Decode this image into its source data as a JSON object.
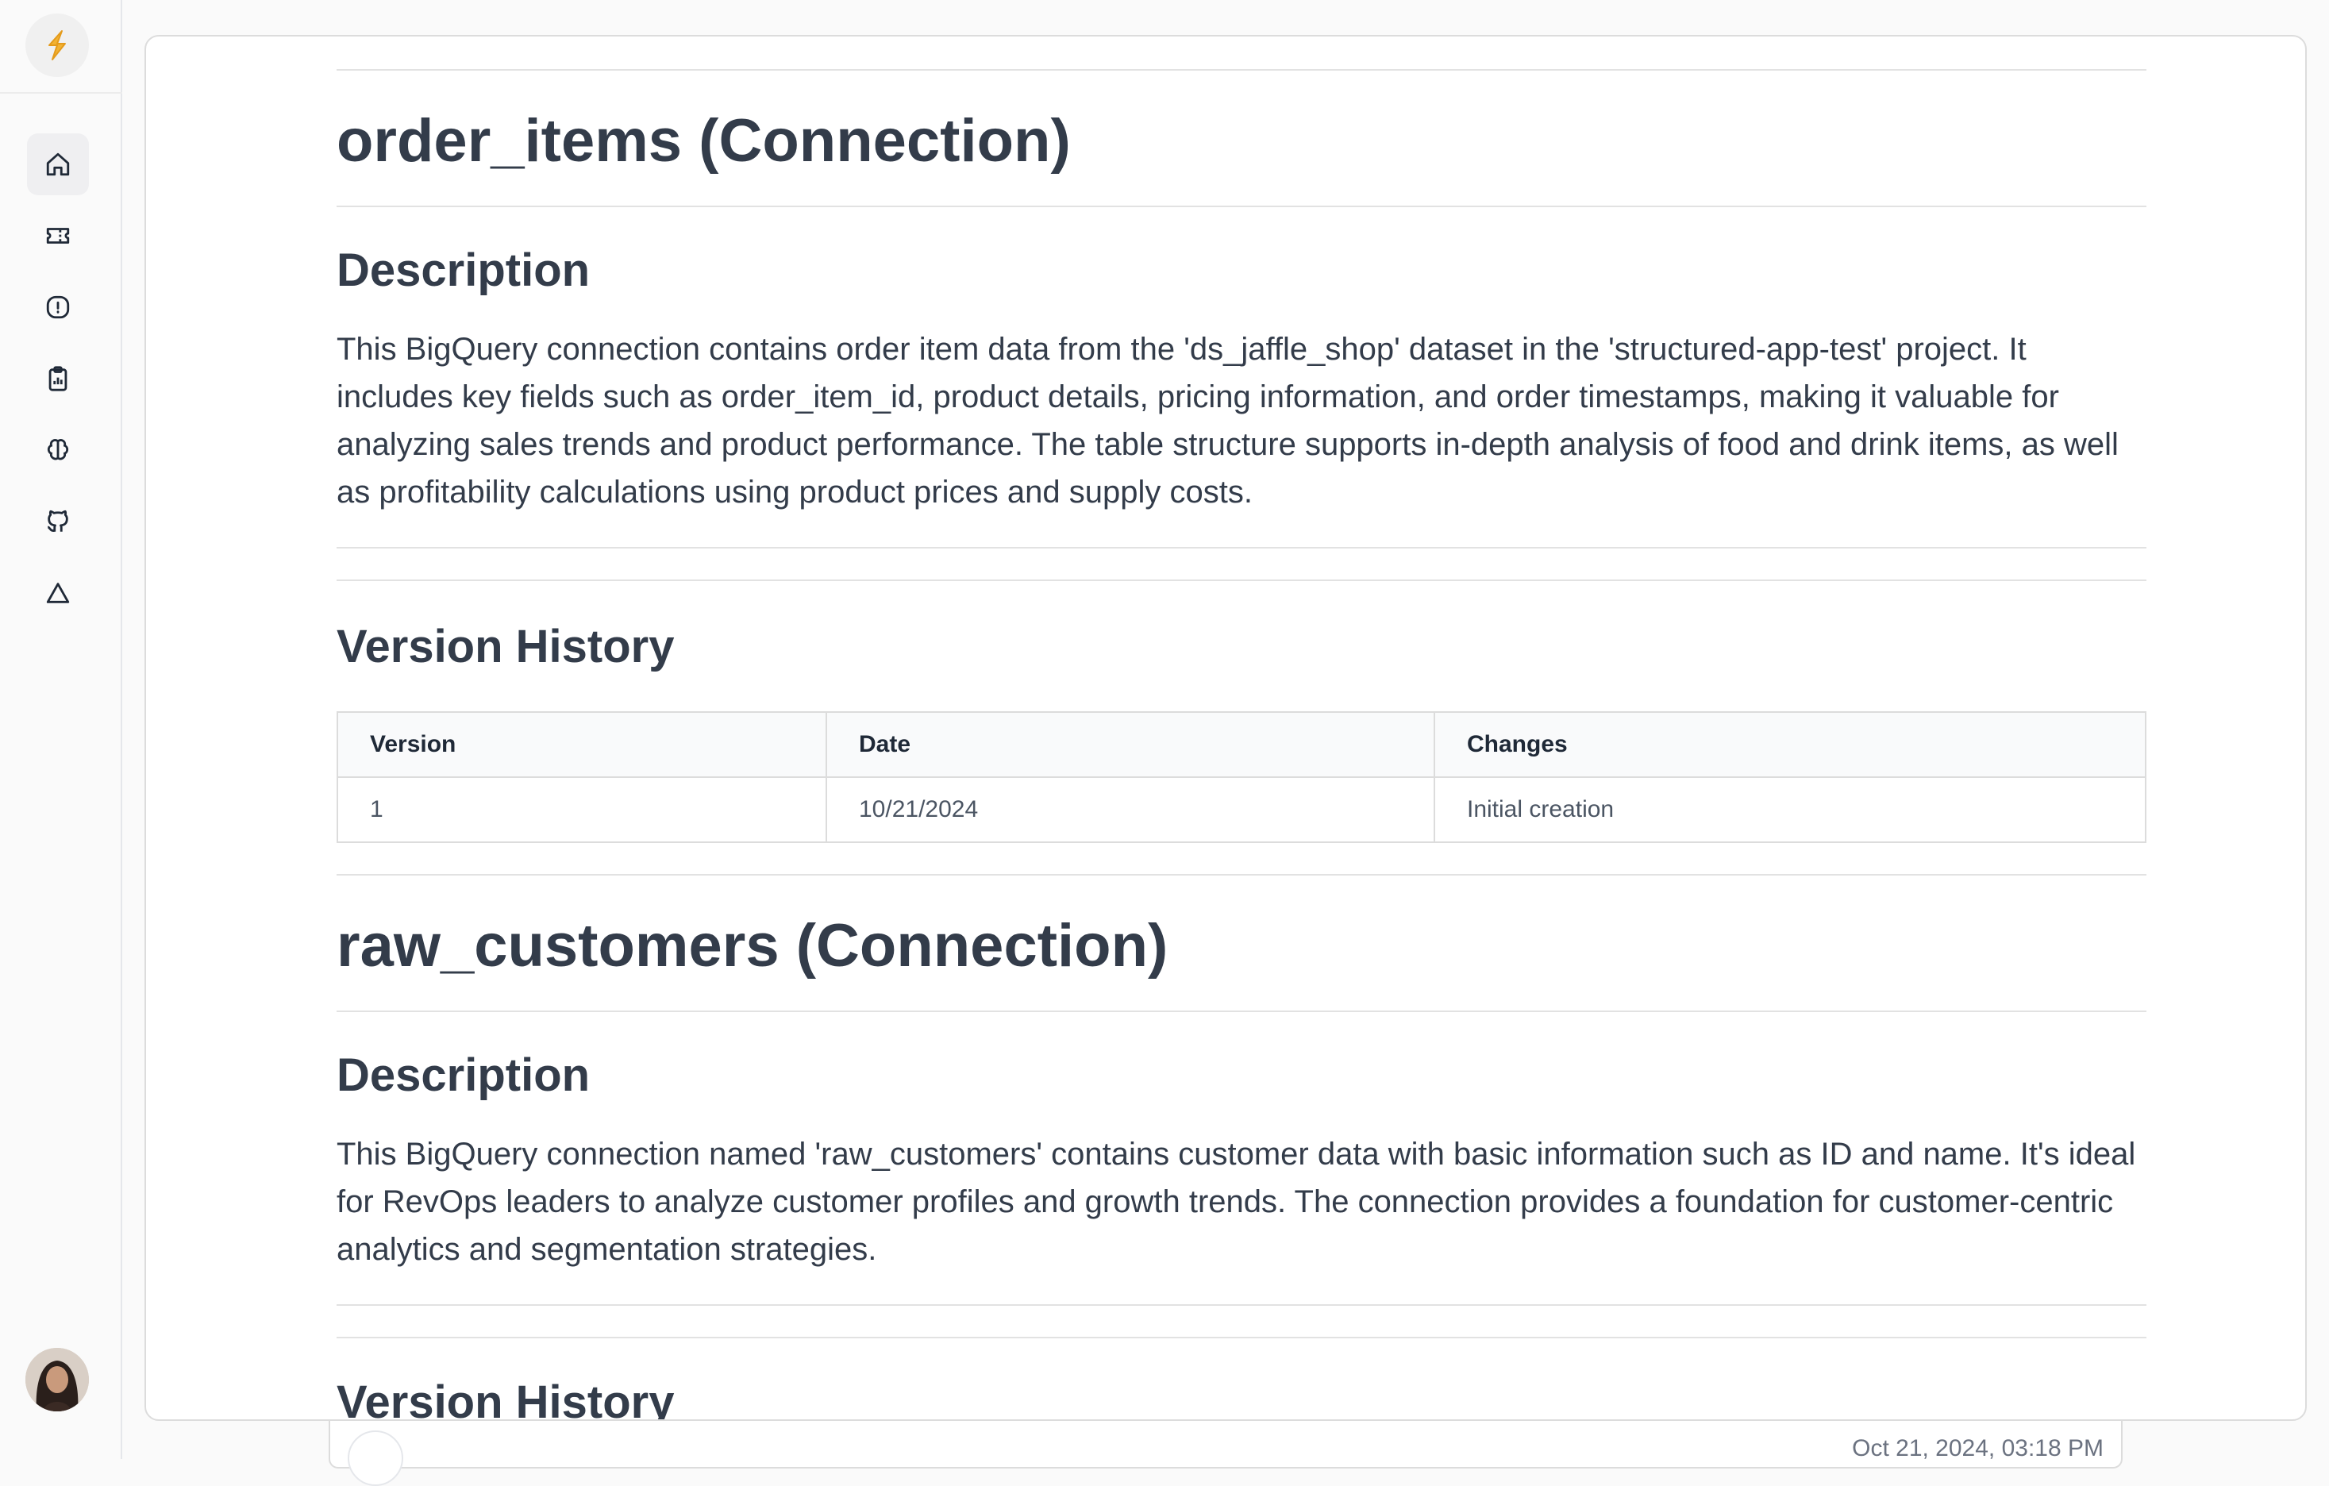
{
  "sidebar": {
    "logo_icon": "structured-logo-icon",
    "nav": [
      {
        "name": "home-icon",
        "active": true
      },
      {
        "name": "ticket-icon",
        "active": false
      },
      {
        "name": "alert-circle-icon",
        "active": false
      },
      {
        "name": "clipboard-chart-icon",
        "active": false
      },
      {
        "name": "brain-icon",
        "active": false
      },
      {
        "name": "github-icon",
        "active": false
      },
      {
        "name": "triangle-icon",
        "active": false
      }
    ],
    "avatar_icon": "user-avatar"
  },
  "doc": {
    "sections": [
      {
        "title": "order_items (Connection)",
        "description_heading": "Description",
        "description": "This BigQuery connection contains order item data from the 'ds_jaffle_shop' dataset in the 'structured-app-test' project. It includes key fields such as order_item_id, product details, pricing information, and order timestamps, making it valuable for analyzing sales trends and product performance. The table structure supports in-depth analysis of food and drink items, as well as profitability calculations using product prices and supply costs.",
        "history_heading": "Version History",
        "history_columns": [
          "Version",
          "Date",
          "Changes"
        ],
        "history_rows": [
          [
            "1",
            "10/21/2024",
            "Initial creation"
          ]
        ]
      },
      {
        "title": "raw_customers (Connection)",
        "description_heading": "Description",
        "description": "This BigQuery connection named 'raw_customers' contains customer data with basic information such as ID and name. It's ideal for RevOps leaders to analyze customer profiles and growth trends. The connection provides a foundation for customer-centric analytics and segmentation strategies.",
        "history_heading": "Version History"
      }
    ]
  },
  "footer": {
    "timestamp": "Oct 21, 2024, 03:18 PM"
  },
  "colors": {
    "heading": "#333c4a",
    "border": "#dcdcdc",
    "logo_accent": "#f2b233"
  }
}
